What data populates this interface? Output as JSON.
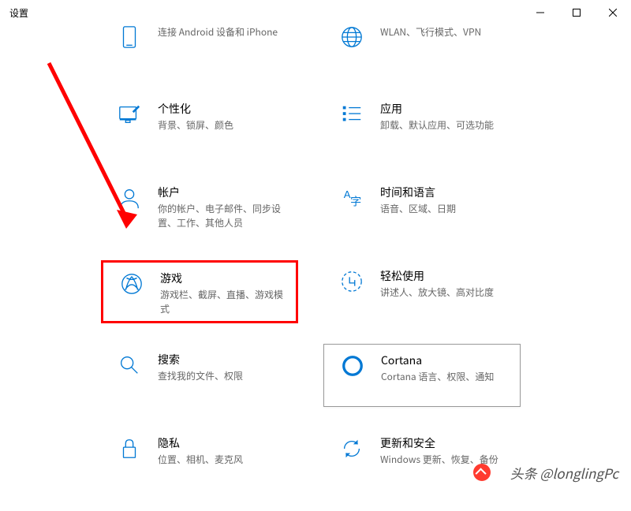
{
  "window": {
    "title": "设置"
  },
  "tiles": {
    "r0": {
      "left": {
        "desc": "连接 Android 设备和 iPhone"
      },
      "right": {
        "desc": "WLAN、飞行模式、VPN"
      }
    },
    "r1": {
      "left": {
        "title": "个性化",
        "desc": "背景、锁屏、颜色"
      },
      "right": {
        "title": "应用",
        "desc": "卸载、默认应用、可选功能"
      }
    },
    "r2": {
      "left": {
        "title": "帐户",
        "desc": "你的帐户、电子邮件、同步设置、工作、其他人员"
      },
      "right": {
        "title": "时间和语言",
        "desc": "语音、区域、日期"
      }
    },
    "r3": {
      "left": {
        "title": "游戏",
        "desc": "游戏栏、截屏、直播、游戏模式"
      },
      "right": {
        "title": "轻松使用",
        "desc": "讲述人、放大镜、高对比度"
      }
    },
    "r4": {
      "left": {
        "title": "搜索",
        "desc": "查找我的文件、权限"
      },
      "right": {
        "title": "Cortana",
        "desc": "Cortana 语言、权限、通知"
      }
    },
    "r5": {
      "left": {
        "title": "隐私",
        "desc": "位置、相机、麦克风"
      },
      "right": {
        "title": "更新和安全",
        "desc": "Windows 更新、恢复、备份"
      }
    }
  },
  "watermark": "头条 @longlingPc"
}
